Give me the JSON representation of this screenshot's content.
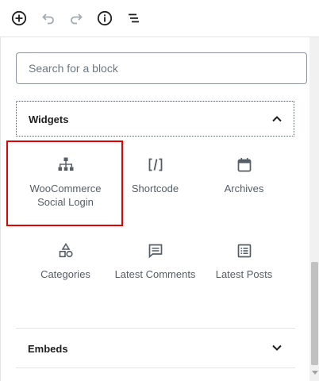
{
  "toolbar": {
    "buttons": [
      {
        "name": "add-block-button",
        "icon": "plus-circle-icon"
      },
      {
        "name": "undo-button",
        "icon": "undo-icon",
        "state": "disabled"
      },
      {
        "name": "redo-button",
        "icon": "redo-icon",
        "state": "disabled"
      },
      {
        "name": "info-button",
        "icon": "info-icon"
      },
      {
        "name": "outline-button",
        "icon": "list-outline-icon"
      }
    ]
  },
  "search": {
    "placeholder": "Search for a block",
    "value": ""
  },
  "sections": {
    "widgets": {
      "title": "Widgets",
      "expanded": true,
      "blocks": [
        {
          "label": "WooCommerce Social Login",
          "icon": "sitemap-icon",
          "highlighted": true
        },
        {
          "label": "Shortcode",
          "icon": "shortcode-icon"
        },
        {
          "label": "Archives",
          "icon": "calendar-icon"
        },
        {
          "label": "Categories",
          "icon": "shapes-icon"
        },
        {
          "label": "Latest Comments",
          "icon": "comment-icon"
        },
        {
          "label": "Latest Posts",
          "icon": "post-list-icon"
        }
      ]
    },
    "embeds": {
      "title": "Embeds",
      "expanded": false
    }
  },
  "colors": {
    "highlight": "#e00000",
    "text": "#1e1e1e",
    "muted": "#555d66",
    "disabled": "#a2aab2"
  }
}
